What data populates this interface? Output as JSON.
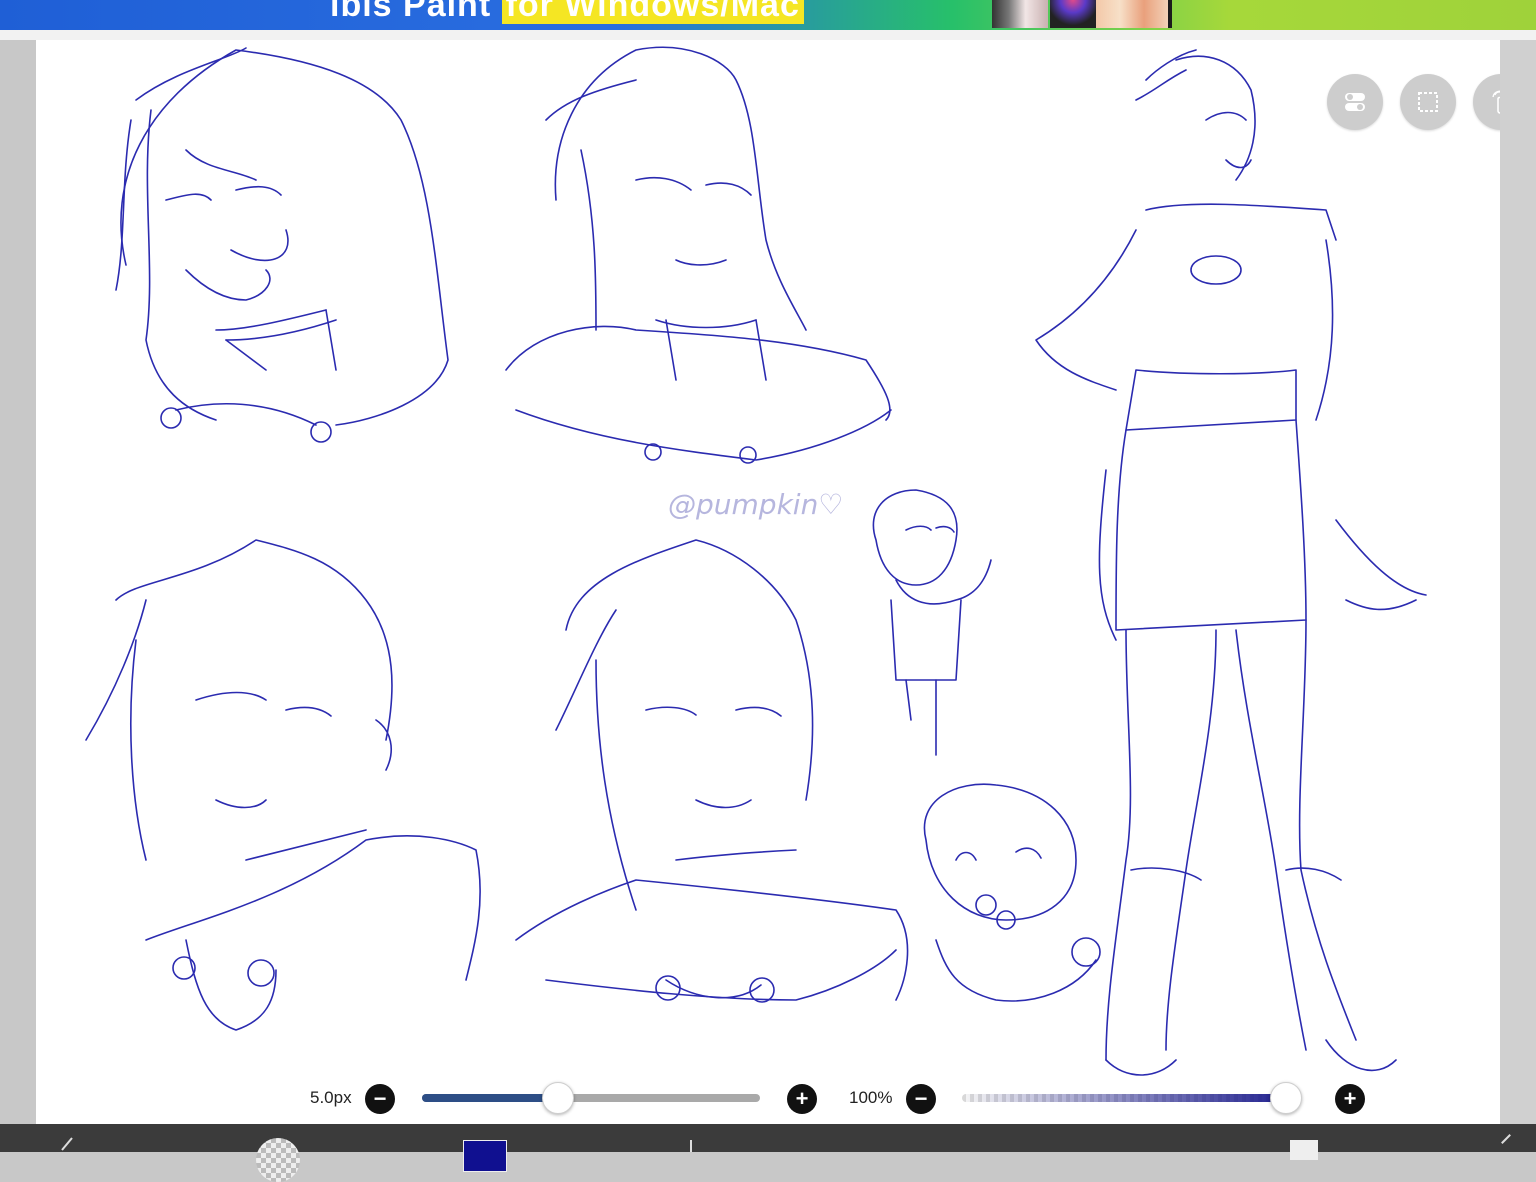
{
  "ad_banner": {
    "text_prefix": "ibis Paint",
    "text_highlight": "for Windows/Mac"
  },
  "watermark": "@pumpkin♡",
  "floating_buttons": [
    {
      "name": "toggle-icon"
    },
    {
      "name": "selection-icon"
    },
    {
      "name": "touch-hand-icon"
    }
  ],
  "brush_size": {
    "label": "5.0px",
    "fraction": 0.4
  },
  "opacity": {
    "label": "100%",
    "fraction": 1.0
  },
  "colors": {
    "current_color": "#101090",
    "sketch_stroke": "#2b2bb0"
  }
}
